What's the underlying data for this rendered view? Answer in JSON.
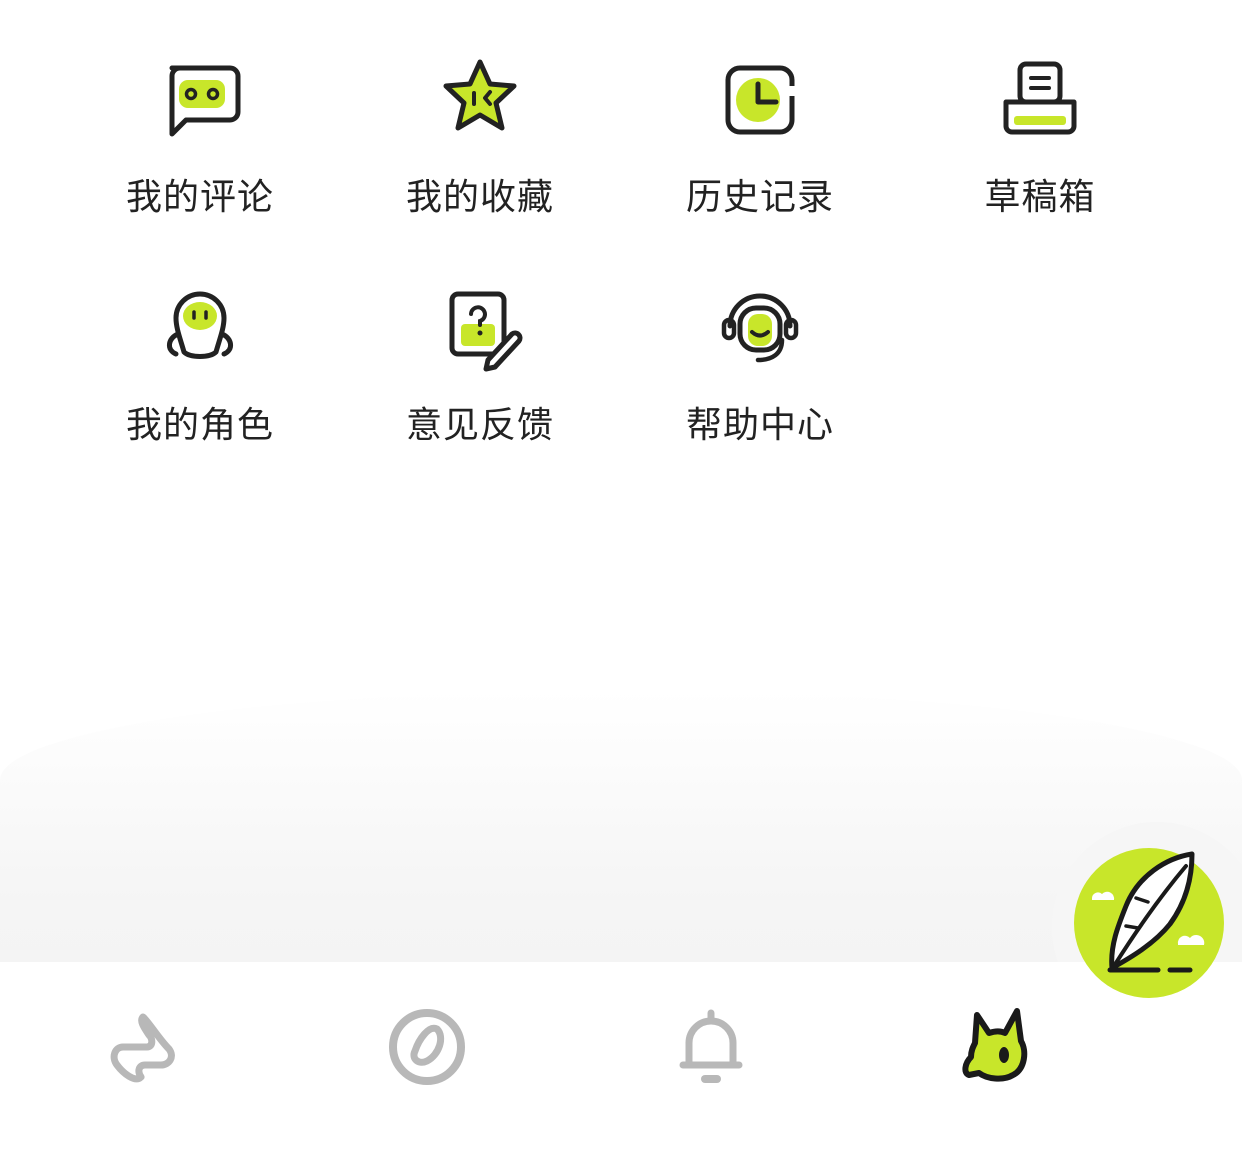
{
  "theme": {
    "accent": "#c8e62a",
    "ink": "#222222",
    "tab_inactive": "#b8b8b8"
  },
  "menu": [
    {
      "label": "我的评论",
      "icon": "chat-bubble-face-icon"
    },
    {
      "label": "我的收藏",
      "icon": "star-face-icon"
    },
    {
      "label": "历史记录",
      "icon": "clock-icon"
    },
    {
      "label": "草稿箱",
      "icon": "draft-tray-icon"
    },
    {
      "label": "我的角色",
      "icon": "character-icon"
    },
    {
      "label": "意见反馈",
      "icon": "feedback-question-pen-icon"
    },
    {
      "label": "帮助中心",
      "icon": "headset-support-icon"
    }
  ],
  "tabbar": [
    {
      "icon": "home-icon",
      "active": false
    },
    {
      "icon": "compass-icon",
      "active": false
    },
    {
      "icon": "bell-icon",
      "active": false
    },
    {
      "icon": "profile-creature-icon",
      "active": true
    }
  ],
  "fab": {
    "icon": "feather-quill-icon"
  }
}
